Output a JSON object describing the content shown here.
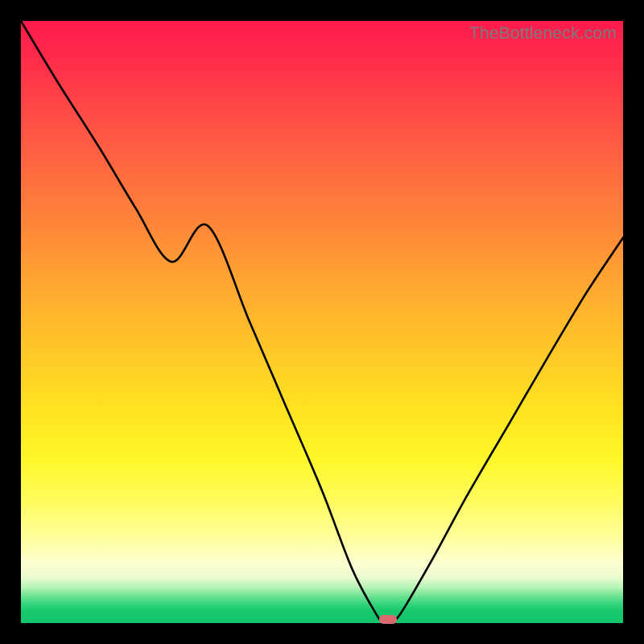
{
  "watermark": "TheBottleneck.com",
  "colors": {
    "gradient_top": "#ff1a4d",
    "gradient_mid": "#ffe420",
    "gradient_bottom": "#15c56b",
    "curve": "#000000",
    "marker": "#d96a6f",
    "frame": "#000000"
  },
  "chart_data": {
    "type": "line",
    "title": "",
    "xlabel": "",
    "ylabel": "",
    "xlim": [
      0,
      100
    ],
    "ylim": [
      0,
      100
    ],
    "grid": false,
    "legend": false,
    "series": [
      {
        "name": "bottleneck-curve",
        "x": [
          0,
          6,
          13,
          19,
          25,
          31,
          38,
          44,
          50,
          55,
          59,
          60,
          61.5,
          63,
          68,
          74,
          81,
          88,
          94,
          100
        ],
        "y_pct": [
          100,
          90,
          79,
          69,
          60,
          66,
          50,
          36,
          22,
          9,
          1.5,
          0.5,
          0.5,
          1.5,
          10,
          21,
          33,
          45,
          55,
          64
        ]
      }
    ],
    "marker": {
      "x_pct": 61,
      "y_pct": 0.5
    },
    "notes": "y_pct is the height of the black curve as a percentage of the plot height (0 = bottom/green, 100 = top/red). Values estimated from pixels."
  }
}
